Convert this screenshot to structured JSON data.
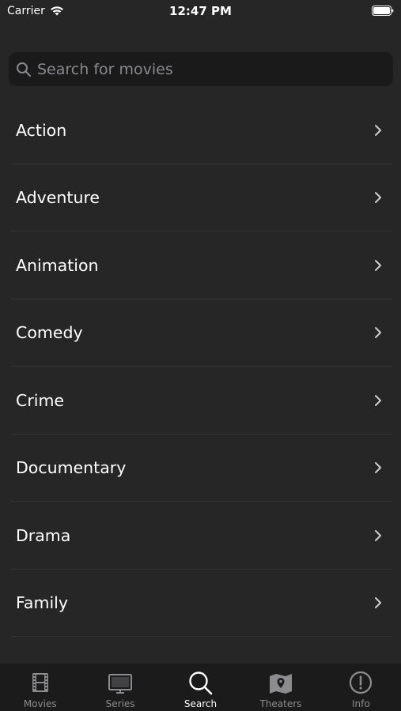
{
  "status_bar": {
    "carrier": "Carrier",
    "time": "12:47 PM"
  },
  "search": {
    "placeholder": "Search for movies",
    "value": ""
  },
  "genres": [
    {
      "label": "Action"
    },
    {
      "label": "Adventure"
    },
    {
      "label": "Animation"
    },
    {
      "label": "Comedy"
    },
    {
      "label": "Crime"
    },
    {
      "label": "Documentary"
    },
    {
      "label": "Drama"
    },
    {
      "label": "Family"
    }
  ],
  "tab_bar": {
    "tabs": [
      {
        "label": "Movies",
        "icon": "film-icon",
        "active": false
      },
      {
        "label": "Series",
        "icon": "tv-icon",
        "active": false
      },
      {
        "label": "Search",
        "icon": "search-icon",
        "active": true
      },
      {
        "label": "Theaters",
        "icon": "map-pin-icon",
        "active": false
      },
      {
        "label": "Info",
        "icon": "info-icon",
        "active": false
      }
    ]
  },
  "colors": {
    "background": "#262627",
    "tab_bar_background": "#1b1b1c",
    "search_field_background": "#1a1a1b",
    "inactive_tab": "#8c8c8e",
    "active_tab": "#ffffff"
  }
}
